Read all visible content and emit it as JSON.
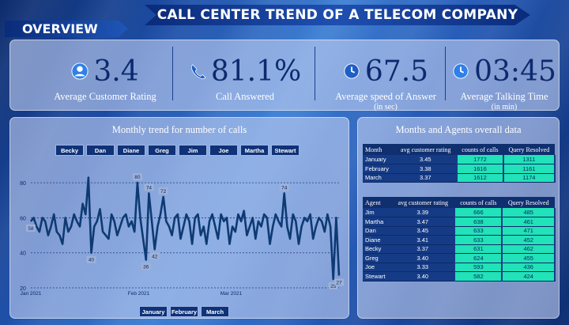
{
  "header": {
    "title": "CALL CENTER TREND OF A TELECOM COMPANY",
    "section": "OVERVIEW"
  },
  "kpis": [
    {
      "value": "3.4",
      "label": "Average Customer Rating",
      "sub": "",
      "icon": "user-icon"
    },
    {
      "value": "81.1%",
      "label": "Call Answered",
      "sub": "",
      "icon": "phone-icon"
    },
    {
      "value": "67.5",
      "label": "Average speed of Answer",
      "sub": "(in sec)",
      "icon": "phone-clock-icon"
    },
    {
      "value": "03:45",
      "label": "Average Talking Time",
      "sub": "(in min)",
      "icon": "clock-icon"
    }
  ],
  "trend": {
    "title": "Monthly trend for number of calls",
    "agents": [
      "Becky",
      "Dan",
      "Diane",
      "Greg",
      "Jim",
      "Joe",
      "Martha",
      "Stewart"
    ],
    "months": [
      "January",
      "February",
      "March"
    ]
  },
  "chart_data": {
    "type": "line",
    "title": "Monthly trend for number of calls",
    "yticks": [
      "80",
      "60",
      "40",
      "20"
    ],
    "ylim": [
      20,
      90
    ],
    "xtick_labels": [
      "Jan 2021",
      "Feb 2021",
      "Mar 2021"
    ],
    "grid": true,
    "annotations": [
      "58",
      "40",
      "80",
      "74",
      "36",
      "42",
      "72",
      "74",
      "25",
      "27"
    ],
    "values": [
      58,
      60,
      55,
      52,
      60,
      58,
      50,
      55,
      62,
      52,
      50,
      45,
      60,
      52,
      55,
      62,
      58,
      55,
      68,
      62,
      83,
      40,
      55,
      58,
      65,
      52,
      50,
      48,
      62,
      58,
      50,
      55,
      60,
      62,
      55,
      58,
      52,
      80,
      60,
      48,
      36,
      74,
      58,
      42,
      55,
      62,
      72,
      58,
      55,
      50,
      60,
      62,
      48,
      55,
      62,
      58,
      45,
      60,
      62,
      50,
      55,
      45,
      58,
      62,
      55,
      48,
      62,
      58,
      60,
      45,
      55,
      52,
      62,
      58,
      64,
      50,
      55,
      60,
      48,
      58,
      55,
      62,
      60,
      45,
      55,
      62,
      58,
      55,
      74,
      55,
      48,
      62,
      58,
      45,
      55,
      60,
      58,
      62,
      48,
      55,
      60,
      58,
      52,
      62,
      55,
      25,
      60,
      27
    ]
  },
  "months_table": {
    "title": "Months and Agents overall data",
    "headers": [
      "Month",
      "avg customer rating",
      "counts of calls",
      "Query Resolved"
    ],
    "rows": [
      [
        "January",
        "3.45",
        "1772",
        "1311"
      ],
      [
        "February",
        "3.38",
        "1616",
        "1161"
      ],
      [
        "March",
        "3.37",
        "1612",
        "1174"
      ]
    ]
  },
  "agents_table": {
    "headers": [
      "Agent",
      "avg customer rating",
      "counts of calls",
      "Query Resolved"
    ],
    "rows": [
      [
        "Jim",
        "3.39",
        "666",
        "485"
      ],
      [
        "Martha",
        "3.47",
        "638",
        "461"
      ],
      [
        "Dan",
        "3.45",
        "633",
        "471"
      ],
      [
        "Diane",
        "3.41",
        "633",
        "452"
      ],
      [
        "Becky",
        "3.37",
        "631",
        "462"
      ],
      [
        "Greg",
        "3.40",
        "624",
        "455"
      ],
      [
        "Joe",
        "3.33",
        "593",
        "436"
      ],
      [
        "Stewart",
        "3.40",
        "582",
        "424"
      ]
    ]
  },
  "colors": {
    "accent": "#21e2b8",
    "line": "#0e3a73",
    "navy": "#0d2a6e"
  }
}
